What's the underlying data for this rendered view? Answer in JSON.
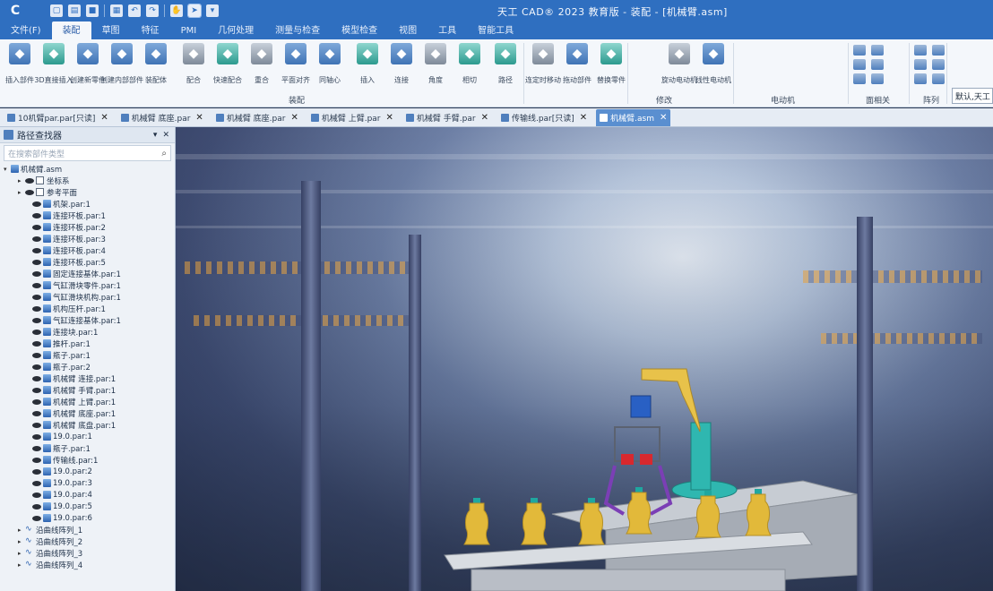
{
  "app": {
    "window_title": "天工 CAD® 2023 教育版 - 装配 - [机械臂.asm]"
  },
  "menu": [
    "文件(F)",
    "装配",
    "草图",
    "特征",
    "PMI",
    "几何处理",
    "测量与检查",
    "模型检查",
    "视图",
    "工具",
    "智能工具"
  ],
  "menu_active_index": 1,
  "ribbon": {
    "buttons": [
      {
        "label": "插入部件",
        "icon": "insert-part-icon"
      },
      {
        "label": "3D直接插入",
        "icon": "direct-insert-icon"
      },
      {
        "label": "创建新零件",
        "icon": "new-part-icon"
      },
      {
        "label": "创建内部部件",
        "icon": "internal-part-icon"
      },
      {
        "label": "装配体",
        "icon": "assembly-icon"
      },
      {
        "label": "配合",
        "icon": "mate-icon"
      },
      {
        "label": "快速配合",
        "icon": "quick-mate-icon"
      },
      {
        "label": "重合",
        "icon": "coincident-icon"
      },
      {
        "label": "平面对齐",
        "icon": "plane-align-icon"
      },
      {
        "label": "同轴心",
        "icon": "concentric-icon"
      },
      {
        "label": "插入",
        "icon": "insert-icon"
      },
      {
        "label": "连接",
        "icon": "connect-icon"
      },
      {
        "label": "角度",
        "icon": "angle-icon"
      },
      {
        "label": "相切",
        "icon": "tangent-icon"
      },
      {
        "label": "路径",
        "icon": "path-icon"
      },
      {
        "label": "连定时移动",
        "icon": "timed-move-icon"
      },
      {
        "label": "拖动部件",
        "icon": "drag-part-icon"
      },
      {
        "label": "替换零件",
        "icon": "replace-part-icon"
      },
      {
        "label": "旋动电动机",
        "icon": "rotary-motor-icon"
      },
      {
        "label": "线性电动机",
        "icon": "linear-motor-icon"
      }
    ],
    "groups": [
      "装配",
      "修改",
      "电动机",
      "面相关",
      "阵列"
    ],
    "combo_value": "默认,天工"
  },
  "doc_tabs": [
    {
      "label": "10机臂par.par[只读]",
      "active": false
    },
    {
      "label": "机械臂 底座.par",
      "active": false
    },
    {
      "label": "机械臂 底座.par",
      "active": false
    },
    {
      "label": "机械臂 上臂.par",
      "active": false
    },
    {
      "label": "机械臂 手臂.par",
      "active": false
    },
    {
      "label": "传输线.par[只读]",
      "active": false
    },
    {
      "label": "机械臂.asm",
      "active": true
    }
  ],
  "pathfinder": {
    "title": "路径查找器",
    "filter_placeholder": "在搜索部件类型",
    "root": "机械臂.asm",
    "nodes": [
      {
        "label": "坐标系",
        "kind": "coord"
      },
      {
        "label": "参考平面",
        "kind": "plane"
      }
    ],
    "items": [
      "机架.par:1",
      "连接环板.par:1",
      "连接环板.par:2",
      "连接环板.par:3",
      "连接环板.par:4",
      "连接环板.par:5",
      "固定连接基体.par:1",
      "气缸滑块零件.par:1",
      "气缸滑块机构.par:1",
      "机构压杆.par:1",
      "气缸连接基体.par:1",
      "连接块.par:1",
      "推杆.par:1",
      "瓶子.par:1",
      "瓶子.par:2",
      "机械臂 连接.par:1",
      "机械臂 手臂.par:1",
      "机械臂 上臂.par:1",
      "机械臂 底座.par:1",
      "机械臂 底盘.par:1",
      "19.0.par:1",
      "瓶子.par:1",
      "传输线.par:1",
      "19.0.par:2",
      "19.0.par:3",
      "19.0.par:4",
      "19.0.par:5",
      "19.0.par:6"
    ],
    "patterns": [
      "沿曲线阵列_1",
      "沿曲线阵列_2",
      "沿曲线阵列_3",
      "沿曲线阵列_4"
    ]
  },
  "colors": {
    "title_bar": "#2f6fc0",
    "arm_yellow": "#e8c24a",
    "arm_teal": "#2fb7b0",
    "bottle_gold": "#e2b93a",
    "cap_teal": "#1fa7a0",
    "gripper_red": "#d8282e",
    "gripper_purple": "#7b3fb5"
  }
}
